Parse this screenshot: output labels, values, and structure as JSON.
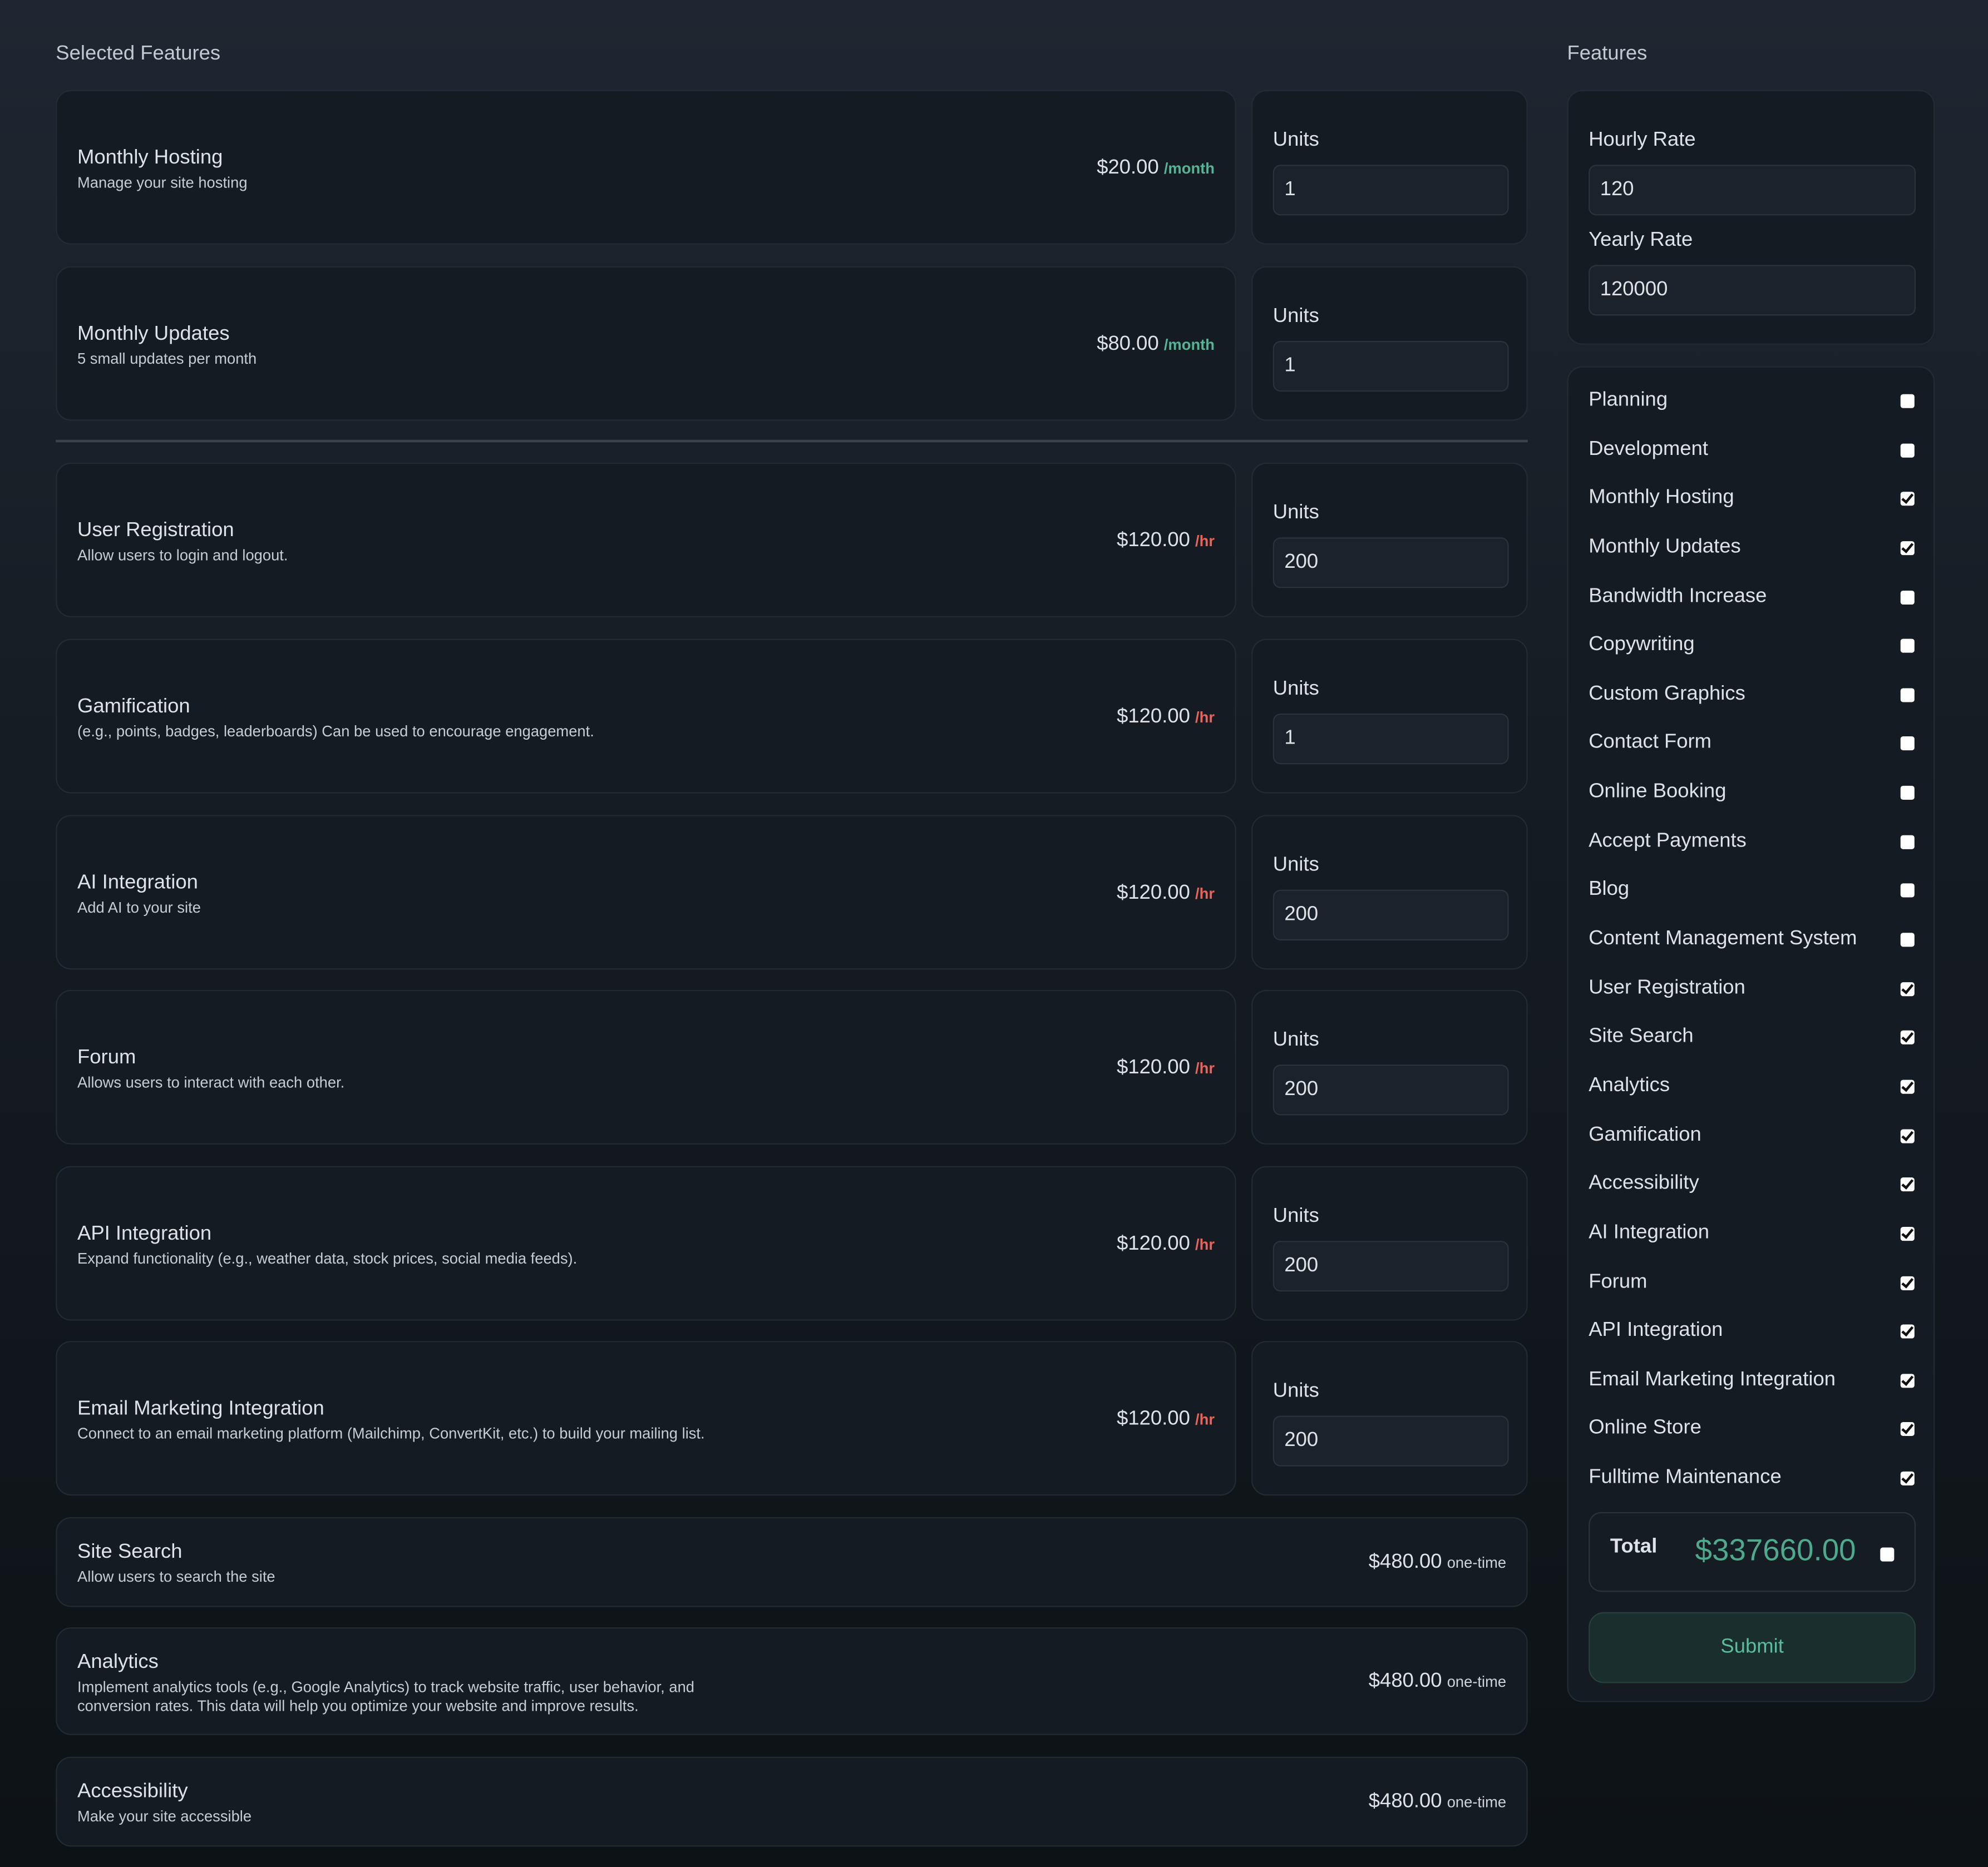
{
  "selected_features": {
    "title": "Selected Features",
    "recurring": [
      {
        "name": "Monthly Hosting",
        "description": "Manage your site hosting",
        "price": "$20.00",
        "unit": "/month",
        "units_label": "Units",
        "units_value": "1"
      },
      {
        "name": "Monthly Updates",
        "description": "5 small updates per month",
        "price": "$80.00",
        "unit": "/month",
        "units_label": "Units",
        "units_value": "1"
      }
    ],
    "hourly": [
      {
        "name": "User Registration",
        "description": "Allow users to login and logout.",
        "price": "$120.00",
        "unit": "/hr",
        "units_label": "Units",
        "units_value": "200"
      },
      {
        "name": "Gamification",
        "description": "(e.g., points, badges, leaderboards) Can be used to encourage engagement.",
        "price": "$120.00",
        "unit": "/hr",
        "units_label": "Units",
        "units_value": "1"
      },
      {
        "name": "AI Integration",
        "description": "Add AI to your site",
        "price": "$120.00",
        "unit": "/hr",
        "units_label": "Units",
        "units_value": "200"
      },
      {
        "name": "Forum",
        "description": "Allows users to interact with each other.",
        "price": "$120.00",
        "unit": "/hr",
        "units_label": "Units",
        "units_value": "200"
      },
      {
        "name": "API Integration",
        "description": "Expand functionality (e.g., weather data, stock prices, social media feeds).",
        "price": "$120.00",
        "unit": "/hr",
        "units_label": "Units",
        "units_value": "200"
      },
      {
        "name": "Email Marketing Integration",
        "description": "Connect to an email marketing platform (Mailchimp, ConvertKit, etc.) to build your mailing list.",
        "price": "$120.00",
        "unit": "/hr",
        "units_label": "Units",
        "units_value": "200"
      }
    ],
    "onetime": [
      {
        "name": "Site Search",
        "description": "Allow users to search the site",
        "price": "$480.00",
        "unit": "one-time"
      },
      {
        "name": "Analytics",
        "description": "Implement analytics tools (e.g., Google Analytics) to track website traffic, user behavior, and conversion rates. This data will help you optimize your website and improve results.",
        "price": "$480.00",
        "unit": "one-time"
      },
      {
        "name": "Accessibility",
        "description": "Make your site accessible",
        "price": "$480.00",
        "unit": "one-time"
      }
    ]
  },
  "features_panel": {
    "title": "Features",
    "hourly_rate_label": "Hourly Rate",
    "hourly_rate_value": "120",
    "yearly_rate_label": "Yearly Rate",
    "yearly_rate_value": "120000",
    "items": [
      {
        "label": "Planning",
        "checked": false
      },
      {
        "label": "Development",
        "checked": false
      },
      {
        "label": "Monthly Hosting",
        "checked": true
      },
      {
        "label": "Monthly Updates",
        "checked": true
      },
      {
        "label": "Bandwidth Increase",
        "checked": false
      },
      {
        "label": "Copywriting",
        "checked": false
      },
      {
        "label": "Custom Graphics",
        "checked": false
      },
      {
        "label": "Contact Form",
        "checked": false
      },
      {
        "label": "Online Booking",
        "checked": false
      },
      {
        "label": "Accept Payments",
        "checked": false
      },
      {
        "label": "Blog",
        "checked": false
      },
      {
        "label": "Content Management System",
        "checked": false
      },
      {
        "label": "User Registration",
        "checked": true
      },
      {
        "label": "Site Search",
        "checked": true
      },
      {
        "label": "Analytics",
        "checked": true
      },
      {
        "label": "Gamification",
        "checked": true
      },
      {
        "label": "Accessibility",
        "checked": true
      },
      {
        "label": "AI Integration",
        "checked": true
      },
      {
        "label": "Forum",
        "checked": true
      },
      {
        "label": "API Integration",
        "checked": true
      },
      {
        "label": "Email Marketing Integration",
        "checked": true
      },
      {
        "label": "Online Store",
        "checked": true
      },
      {
        "label": "Fulltime Maintenance",
        "checked": true
      }
    ],
    "total_label": "Total",
    "total_value": "$337660.00",
    "submit_label": "Submit"
  },
  "colors": {
    "accent_green": "#4ea98d",
    "hourly_red": "#e8645a",
    "card_bg": "#141b23"
  }
}
